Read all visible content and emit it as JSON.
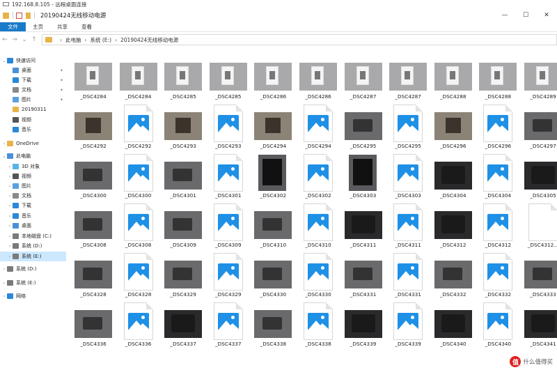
{
  "remote": {
    "title": "192.168.8.105 - 远程桌面连接"
  },
  "window": {
    "title": "20190424无线移动电源",
    "minimize": "—",
    "maximize": "☐",
    "close": "✕"
  },
  "ribbon": {
    "tabs": [
      "文件",
      "主页",
      "共享",
      "查看"
    ]
  },
  "address": {
    "path": [
      "此电脑",
      "系统 (E:)",
      "20190424无线移动电源"
    ],
    "back": "←",
    "forward": "→",
    "up_menu": "⌄",
    "up": "↑"
  },
  "sidebar": {
    "items": [
      {
        "label": "快速访问",
        "icon": "star-icon",
        "color": "#2b88d8"
      },
      {
        "label": "桌面",
        "icon": "desktop-icon",
        "color": "#4a90d9"
      },
      {
        "label": "下载",
        "icon": "download-icon",
        "color": "#2b88d8"
      },
      {
        "label": "文档",
        "icon": "document-icon",
        "color": "#8a8a8a"
      },
      {
        "label": "图片",
        "icon": "picture-icon",
        "color": "#5aa0e0"
      },
      {
        "label": "20190311",
        "icon": "folder-icon",
        "color": "#e8b34a"
      },
      {
        "label": "视频",
        "icon": "video-icon",
        "color": "#555555"
      },
      {
        "label": "音乐",
        "icon": "music-icon",
        "color": "#2b88d8"
      },
      {
        "label": "OneDrive",
        "icon": "onedrive-icon",
        "color": "#e8b34a"
      },
      {
        "label": "此电脑",
        "icon": "computer-icon",
        "color": "#4a90d9"
      },
      {
        "label": "3D 对象",
        "icon": "3d-objects-icon",
        "color": "#58b4e8"
      },
      {
        "label": "视频",
        "icon": "video-icon",
        "color": "#555555"
      },
      {
        "label": "图片",
        "icon": "picture-icon",
        "color": "#5aa0e0"
      },
      {
        "label": "文档",
        "icon": "document-icon",
        "color": "#8a8a8a"
      },
      {
        "label": "下载",
        "icon": "download-icon",
        "color": "#2b88d8"
      },
      {
        "label": "音乐",
        "icon": "music-icon",
        "color": "#2b88d8"
      },
      {
        "label": "桌面",
        "icon": "desktop-icon",
        "color": "#4a90d9"
      },
      {
        "label": "本地磁盘 (C:)",
        "icon": "drive-icon",
        "color": "#7a7a7a"
      },
      {
        "label": "系统 (D:)",
        "icon": "drive-icon",
        "color": "#7a7a7a"
      },
      {
        "label": "系统 (E:)",
        "icon": "drive-icon",
        "color": "#7a7a7a"
      },
      {
        "label": "系统 (D:)",
        "icon": "drive-icon",
        "color": "#7a7a7a"
      },
      {
        "label": "系统 (E:)",
        "icon": "drive-icon",
        "color": "#7a7a7a"
      },
      {
        "label": "网络",
        "icon": "network-icon",
        "color": "#2b88d8"
      }
    ]
  },
  "files": [
    {
      "name": "_DSC4284",
      "kind": "light"
    },
    {
      "name": "_DSC4284",
      "kind": "light"
    },
    {
      "name": "_DSC4285",
      "kind": "light"
    },
    {
      "name": "_DSC4285",
      "kind": "light"
    },
    {
      "name": "_DSC4286",
      "kind": "light"
    },
    {
      "name": "_DSC4286",
      "kind": "light"
    },
    {
      "name": "_DSC4287",
      "kind": "light"
    },
    {
      "name": "_DSC4287",
      "kind": "light"
    },
    {
      "name": "_DSC4288",
      "kind": "light"
    },
    {
      "name": "_DSC4288",
      "kind": "light"
    },
    {
      "name": "_DSC4289",
      "kind": "light"
    },
    {
      "name": "_DSC4292",
      "kind": "warm"
    },
    {
      "name": "_DSC4292",
      "kind": "doc"
    },
    {
      "name": "_DSC4293",
      "kind": "warm"
    },
    {
      "name": "_DSC4293",
      "kind": "doc"
    },
    {
      "name": "_DSC4294",
      "kind": "warm"
    },
    {
      "name": "_DSC4294",
      "kind": "doc"
    },
    {
      "name": "_DSC4295",
      "kind": "mid"
    },
    {
      "name": "_DSC4295",
      "kind": "doc"
    },
    {
      "name": "_DSC4296",
      "kind": "warm"
    },
    {
      "name": "_DSC4296",
      "kind": "doc"
    },
    {
      "name": "_DSC4297",
      "kind": "mid"
    },
    {
      "name": "_DSC4300",
      "kind": "mid"
    },
    {
      "name": "_DSC4300",
      "kind": "doc"
    },
    {
      "name": "_DSC4301",
      "kind": "mid"
    },
    {
      "name": "_DSC4301",
      "kind": "doc"
    },
    {
      "name": "_DSC4302",
      "kind": "tall"
    },
    {
      "name": "_DSC4302",
      "kind": "doc"
    },
    {
      "name": "_DSC4303",
      "kind": "tall"
    },
    {
      "name": "_DSC4303",
      "kind": "doc"
    },
    {
      "name": "_DSC4304",
      "kind": "dark"
    },
    {
      "name": "_DSC4304",
      "kind": "doc"
    },
    {
      "name": "_DSC4305",
      "kind": "dark"
    },
    {
      "name": "_DSC4308",
      "kind": "mid"
    },
    {
      "name": "_DSC4308",
      "kind": "doc"
    },
    {
      "name": "_DSC4309",
      "kind": "mid"
    },
    {
      "name": "_DSC4309",
      "kind": "doc"
    },
    {
      "name": "_DSC4310",
      "kind": "mid"
    },
    {
      "name": "_DSC4310",
      "kind": "doc"
    },
    {
      "name": "_DSC4311",
      "kind": "dark"
    },
    {
      "name": "_DSC4311",
      "kind": "doc"
    },
    {
      "name": "_DSC4312",
      "kind": "dark"
    },
    {
      "name": "_DSC4312",
      "kind": "doc"
    },
    {
      "name": "_DSC4312...",
      "kind": "blank"
    },
    {
      "name": "_DSC4328",
      "kind": "mid"
    },
    {
      "name": "_DSC4328",
      "kind": "doc"
    },
    {
      "name": "_DSC4329",
      "kind": "mid"
    },
    {
      "name": "_DSC4329",
      "kind": "doc"
    },
    {
      "name": "_DSC4330",
      "kind": "mid"
    },
    {
      "name": "_DSC4330",
      "kind": "doc"
    },
    {
      "name": "_DSC4331",
      "kind": "mid"
    },
    {
      "name": "_DSC4331",
      "kind": "doc"
    },
    {
      "name": "_DSC4332",
      "kind": "mid"
    },
    {
      "name": "_DSC4332",
      "kind": "doc"
    },
    {
      "name": "_DSC4333",
      "kind": "mid"
    },
    {
      "name": "_DSC4336",
      "kind": "mid"
    },
    {
      "name": "_DSC4336",
      "kind": "doc"
    },
    {
      "name": "_DSC4337",
      "kind": "dark"
    },
    {
      "name": "_DSC4337",
      "kind": "doc"
    },
    {
      "name": "_DSC4338",
      "kind": "mid"
    },
    {
      "name": "_DSC4338",
      "kind": "doc"
    },
    {
      "name": "_DSC4339",
      "kind": "dark"
    },
    {
      "name": "_DSC4339",
      "kind": "doc"
    },
    {
      "name": "_DSC4340",
      "kind": "dark"
    },
    {
      "name": "_DSC4340",
      "kind": "doc"
    },
    {
      "name": "_DSC4341",
      "kind": "dark"
    }
  ],
  "watermark": {
    "badge": "值",
    "text": "什么值得买"
  }
}
